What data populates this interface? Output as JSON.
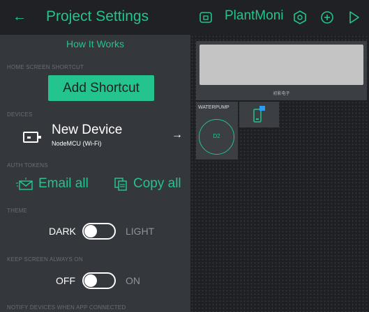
{
  "settings": {
    "title": "Project Settings",
    "back_icon": "back-arrow-icon",
    "how_it_works": "How It Works",
    "home_shortcut_label": "HOME SCREEN SHORTCUT",
    "add_shortcut": "Add Shortcut",
    "devices_label": "DEVICES",
    "device_name": "New Device",
    "device_sub": "NodeMCU (Wi-Fi)",
    "auth_tokens_label": "AUTH TOKENS",
    "email_all": "Email all",
    "copy_all": "Copy all",
    "theme_label": "THEME",
    "theme_left": "DARK",
    "theme_right": "LIGHT",
    "keep_screen_label": "KEEP SCREEN ALWAYS ON",
    "keep_left": "OFF",
    "keep_right": "ON",
    "notify_label": "NOTIFY DEVICES WHEN APP CONNECTED"
  },
  "canvas": {
    "title": "PlantMoni",
    "header_icons": [
      "device-mode-icon",
      "settings-hexagon-icon",
      "add-circle-icon",
      "play-icon"
    ],
    "lcd_caption": "初影电子",
    "pump_label": "WATERPUMP",
    "pump_pin": "D2"
  },
  "colors": {
    "accent": "#23c48e",
    "panel": "#34373c",
    "header": "#1f2124",
    "widget": "#3b3e43"
  }
}
